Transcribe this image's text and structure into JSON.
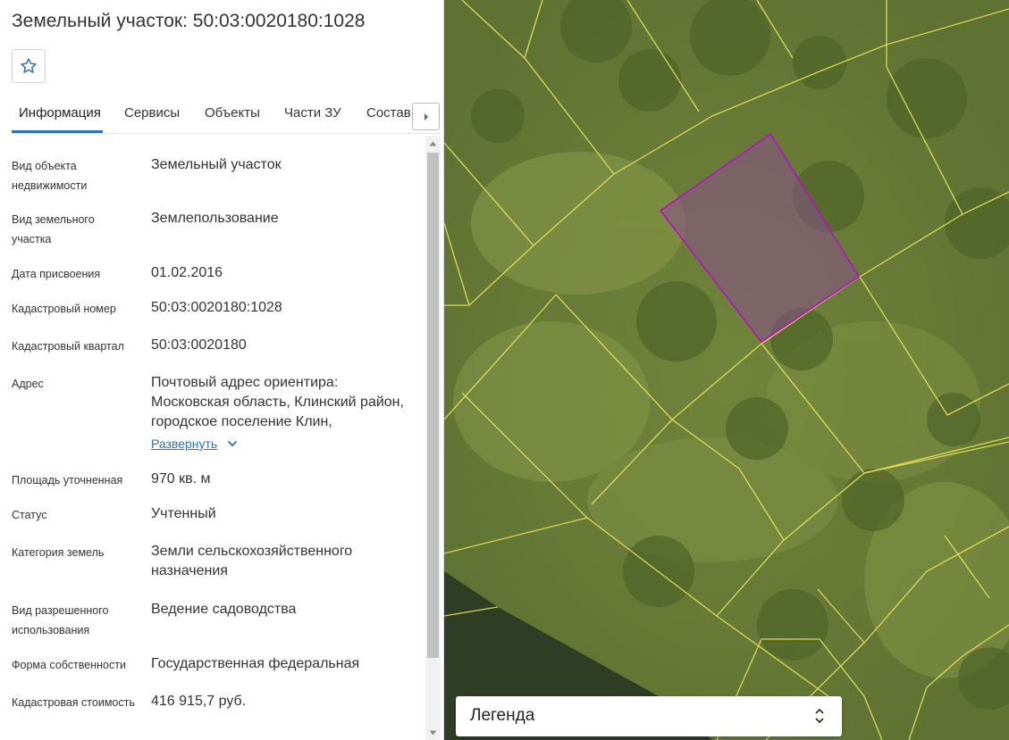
{
  "title": "Земельный участок: 50:03:0020180:1028",
  "tabs": [
    "Информация",
    "Сервисы",
    "Объекты",
    "Части ЗУ",
    "Состав"
  ],
  "info": {
    "rows": [
      {
        "label": "Вид объекта недвижимости",
        "value": "Земельный участок"
      },
      {
        "label": "Вид земельного участка",
        "value": "Землепользование"
      },
      {
        "label": "Дата присвоения",
        "value": "01.02.2016"
      },
      {
        "label": "Кадастровый номер",
        "value": "50:03:0020180:1028"
      },
      {
        "label": "Кадастровый квартал",
        "value": "50:03:0020180"
      },
      {
        "label": "Адрес",
        "value": "Почтовый адрес ориентира: Московская область, Клинский район, городское поселение Клин,"
      },
      {
        "label": "Площадь уточненная",
        "value": "970 кв. м"
      },
      {
        "label": "Статус",
        "value": "Учтенный"
      },
      {
        "label": "Категория земель",
        "value": "Земли сельскохозяйственного назначения"
      },
      {
        "label": "Вид разрешенного использования",
        "value": "Ведение садоводства"
      },
      {
        "label": "Форма собственности",
        "value": "Государственная федеральная"
      },
      {
        "label": "Кадастровая стоимость",
        "value": "416 915,7 руб."
      }
    ],
    "expand_label": "Развернуть"
  },
  "legend": {
    "label": "Легенда"
  },
  "colors": {
    "accent": "#2b73b8",
    "parcel_outline": "#b01ab8",
    "parcel_fill": "#8a4e8e",
    "boundary": "#e9e35a"
  },
  "icons": {
    "favorite": "star-icon",
    "tab_next": "chevron-right-icon",
    "expand": "chevron-down-icon",
    "legend_toggle": "up-down-arrows-icon"
  }
}
